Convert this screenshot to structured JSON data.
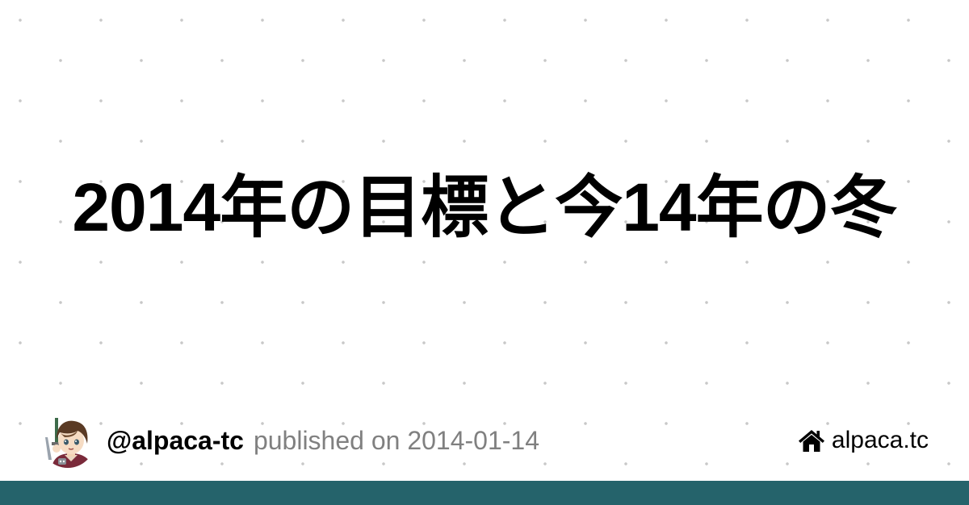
{
  "post": {
    "title": "2014年の目標と今14年の冬"
  },
  "author": {
    "handle": "@alpaca-tc",
    "avatar_icon": "avatar-illustration"
  },
  "meta": {
    "published": "published on 2014-01-14"
  },
  "site": {
    "icon": "home-icon",
    "label": "alpaca.tc"
  },
  "colors": {
    "background": "#ffffff",
    "dot": "#c8c8c8",
    "title": "#000000",
    "published_text": "#808080",
    "bottom_bar": "#25636b"
  }
}
